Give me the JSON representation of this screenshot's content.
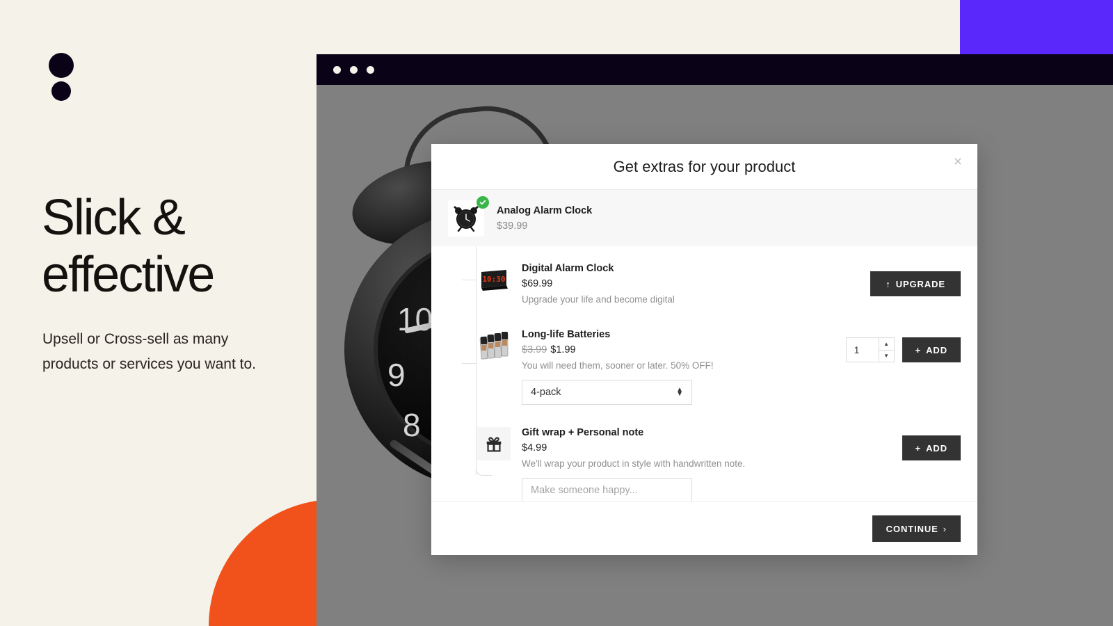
{
  "brand": {
    "logo_icon": "two-dots-logo",
    "headline_line1": "Slick &",
    "headline_line2": "effective",
    "subtext": "Upsell or Cross-sell as many products or services you want to."
  },
  "colors": {
    "page_bg": "#f5f2ea",
    "accent_purple": "#5a28fb",
    "accent_orange": "#f1511b",
    "chrome_dark": "#0a0318",
    "viewport_gray": "#808080",
    "button_dark": "#333333",
    "badge_green": "#3ab54a"
  },
  "browser": {
    "dots": [
      "dot-1",
      "dot-2",
      "dot-3"
    ]
  },
  "modal": {
    "title": "Get extras for your product",
    "close_label": "×",
    "parent_product": {
      "name": "Analog Alarm Clock",
      "price": "$39.99",
      "badge_icon": "check-badge-icon",
      "thumb_icon": "analog-alarm-clock-thumb"
    },
    "offers": [
      {
        "id": "digital-alarm-clock",
        "name": "Digital Alarm Clock",
        "price": "$69.99",
        "old_price": "",
        "description": "Upgrade your life and become digital",
        "thumb_icon": "digital-clock-thumb",
        "thumb_display": "10:30",
        "action_label": "UPGRADE",
        "action_icon": "arrow-up-icon",
        "has_stepper": false,
        "has_select": false,
        "has_text_input": false
      },
      {
        "id": "long-life-batteries",
        "name": "Long-life Batteries",
        "price": "$1.99",
        "old_price": "$3.99",
        "description": "You will need them, sooner or later. 50% OFF!",
        "thumb_icon": "batteries-thumb",
        "action_label": "ADD",
        "action_icon": "plus-icon",
        "has_stepper": true,
        "quantity": "1",
        "stepper_up_icon": "caret-up-icon",
        "stepper_down_icon": "caret-down-icon",
        "has_select": true,
        "select_value": "4-pack",
        "select_icon": "select-caret-icon",
        "has_text_input": false
      },
      {
        "id": "gift-wrap",
        "name": "Gift wrap + Personal note",
        "price": "$4.99",
        "old_price": "",
        "description": "We'll wrap your product in style with handwritten note.",
        "thumb_icon": "gift-icon",
        "action_label": "ADD",
        "action_icon": "plus-icon",
        "has_stepper": false,
        "has_select": false,
        "has_text_input": true,
        "note_placeholder": "Make someone happy..."
      }
    ],
    "footer": {
      "continue_label": "CONTINUE",
      "continue_icon": "chevron-right-icon"
    }
  }
}
